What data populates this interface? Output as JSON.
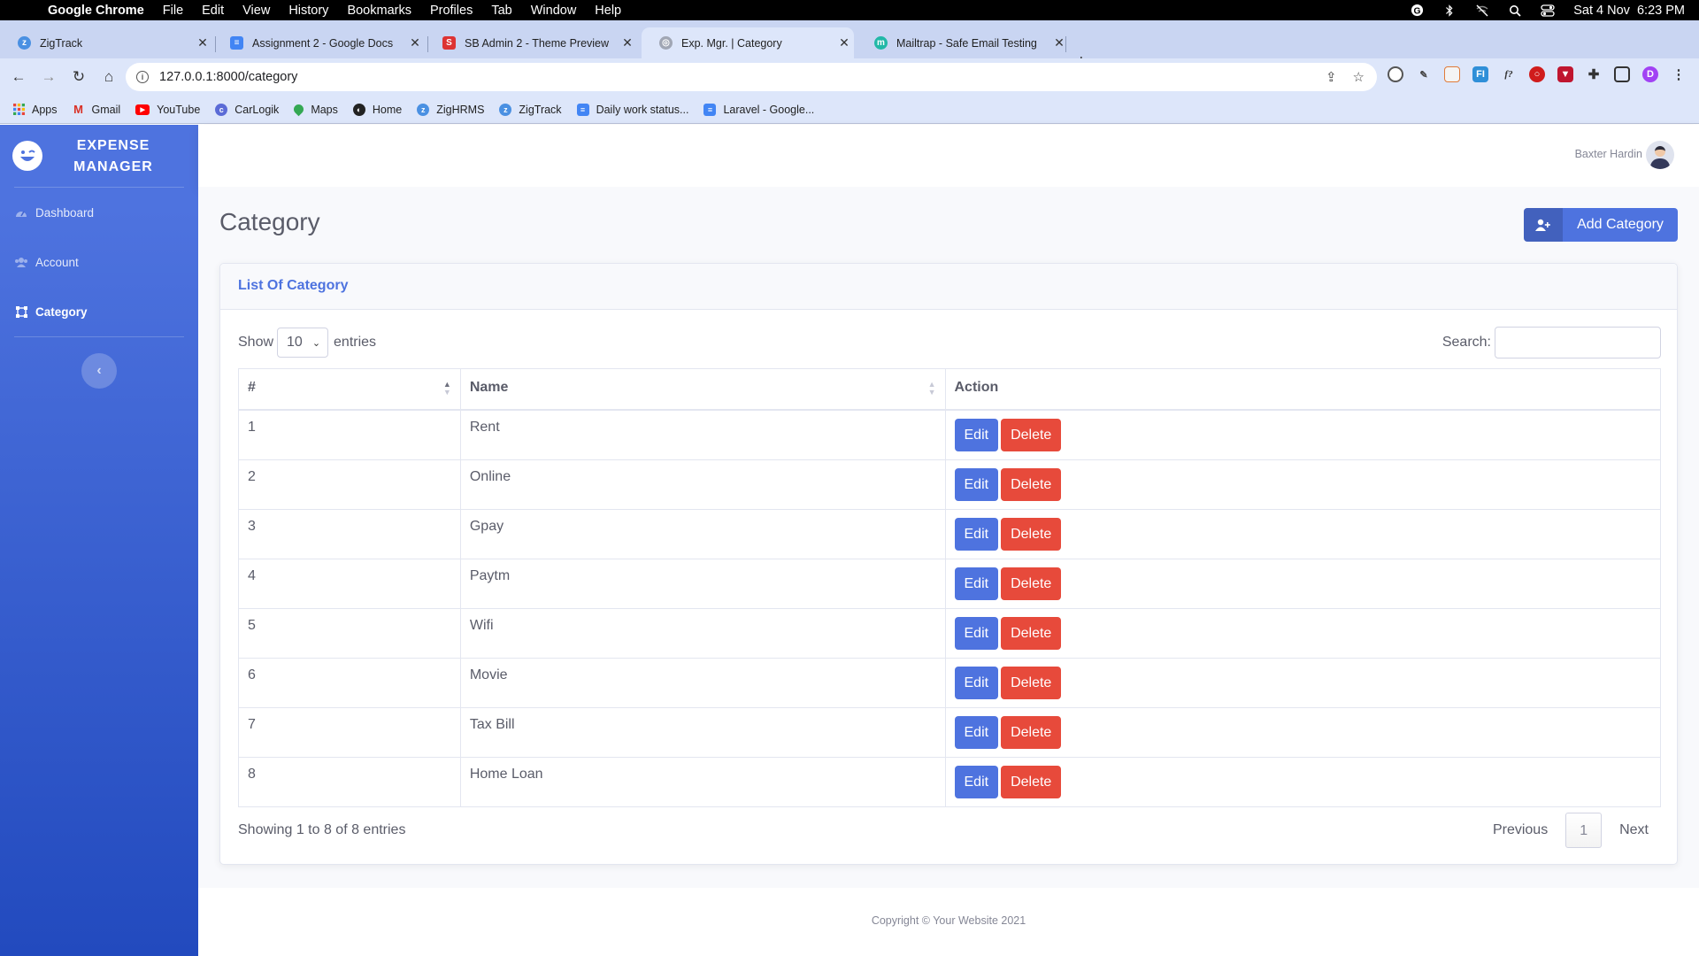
{
  "menubar": {
    "app": "Google Chrome",
    "items": [
      "File",
      "Edit",
      "View",
      "History",
      "Bookmarks",
      "Profiles",
      "Tab",
      "Window",
      "Help"
    ],
    "datetime": "Sat 4 Nov  6:23 PM"
  },
  "tabs": [
    {
      "label": "ZigTrack",
      "icon": "zigtrack-icon",
      "color": "#4a90e2"
    },
    {
      "label": "Assignment 2 - Google Docs",
      "icon": "google-docs-icon",
      "color": "#4285f4"
    },
    {
      "label": "SB Admin 2 - Theme Preview",
      "icon": "startbootstrap-icon",
      "color": "#dd3333"
    },
    {
      "label": "Exp. Mgr. | Category",
      "icon": "globe-icon",
      "color": "#8a8a8a"
    },
    {
      "label": "Mailtrap - Safe Email Testing",
      "icon": "mailtrap-icon",
      "color": "#22b8a7"
    }
  ],
  "address": {
    "url": "127.0.0.1:8000/category"
  },
  "bookmarks": [
    {
      "label": "Apps",
      "icon": "apps-grid-icon",
      "color": "#e8453c"
    },
    {
      "label": "Gmail",
      "icon": "gmail-icon",
      "color": "#d93025"
    },
    {
      "label": "YouTube",
      "icon": "youtube-icon",
      "color": "#ff0000"
    },
    {
      "label": "CarLogik",
      "icon": "carlogik-icon",
      "color": "#5b6bd6"
    },
    {
      "label": "Maps",
      "icon": "maps-icon",
      "color": "#34a853"
    },
    {
      "label": "Home",
      "icon": "home-globe-icon",
      "color": "#222222"
    },
    {
      "label": "ZigHRMS",
      "icon": "zighrms-icon",
      "color": "#4a90e2"
    },
    {
      "label": "ZigTrack",
      "icon": "zigtrack-icon",
      "color": "#4a90e2"
    },
    {
      "label": "Daily work status...",
      "icon": "google-docs-icon",
      "color": "#4285f4"
    },
    {
      "label": "Laravel - Google...",
      "icon": "google-docs-icon",
      "color": "#4285f4"
    }
  ],
  "sidebar": {
    "brand": "Expense Manager",
    "items": [
      {
        "label": "Dashboard",
        "icon": "tachometer-icon"
      },
      {
        "label": "Account",
        "icon": "users-icon"
      },
      {
        "label": "Category",
        "icon": "vector-square-icon",
        "active": true
      }
    ]
  },
  "topbar": {
    "user_name": "Baxter Hardin"
  },
  "page": {
    "title": "Category",
    "add_button": "Add Category",
    "card_title": "List Of Category"
  },
  "datatable": {
    "show_label": "Show",
    "length_value": "10",
    "entries_label": "entries",
    "search_label": "Search:",
    "columns": [
      "#",
      "Name",
      "Action"
    ],
    "rows": [
      {
        "num": "1",
        "name": "Rent"
      },
      {
        "num": "2",
        "name": "Online"
      },
      {
        "num": "3",
        "name": "Gpay"
      },
      {
        "num": "4",
        "name": "Paytm"
      },
      {
        "num": "5",
        "name": "Wifi"
      },
      {
        "num": "6",
        "name": "Movie"
      },
      {
        "num": "7",
        "name": "Tax Bill"
      },
      {
        "num": "8",
        "name": "Home Loan"
      }
    ],
    "edit_label": "Edit",
    "delete_label": "Delete",
    "info": "Showing 1 to 8 of 8 entries",
    "pagination": {
      "previous": "Previous",
      "current": "1",
      "next": "Next"
    }
  },
  "footer": {
    "copyright": "Copyright © Your Website 2021"
  },
  "colors": {
    "primary": "#4e73df",
    "danger": "#e74a3b",
    "text": "#5a5c69"
  }
}
